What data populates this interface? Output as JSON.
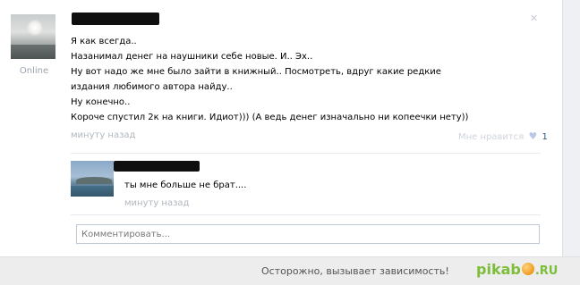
{
  "post": {
    "status": "Online",
    "lines": [
      "Я как всегда..",
      "Назанимал денег на наушники себе новые. И.. Эх..",
      "Ну вот надо же мне было зайти в книжный.. Посмотреть, вдруг какие редкие",
      "издания любимого автора найду..",
      "Ну конечно..",
      "Короче спустил 2к на книги. Идиот))) (А ведь денег изначально ни копеечки нету))"
    ],
    "time": "минуту назад",
    "like_label": "Мне нравится",
    "like_count": "1"
  },
  "reply": {
    "text": "ты мне больше не брат....",
    "time": "минуту назад"
  },
  "comment": {
    "placeholder": "Комментировать..."
  },
  "footer": {
    "warning": "Осторожно, вызывает зависимость!",
    "logo_left": "pikab",
    "logo_right": ".RU"
  },
  "icons": {
    "heart": "heart-icon",
    "close": "close-icon",
    "logo_ball": "pikabu-ball-icon"
  },
  "colors": {
    "link_blue": "#2b587a",
    "meta_gray": "#b0b7bf",
    "pikabu_green": "#7cbd3a"
  }
}
